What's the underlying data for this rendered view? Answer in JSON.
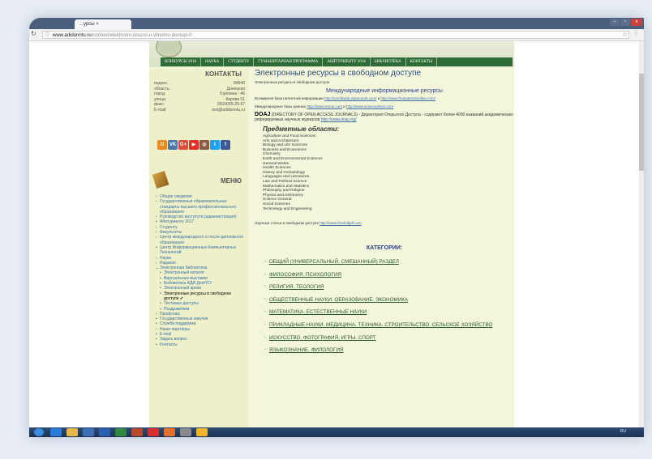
{
  "browser": {
    "tab_title": "...урсы ×",
    "tab_close": "×",
    "url_host": "www.adidonntu.ru",
    "url_path": "/content/elektronni-resursi-u-vilnomu-dostupi-0",
    "star_glyph": "☆",
    "menu_glyph": "⋮"
  },
  "nav": {
    "items": [
      "КОНКУРСЫ 2018",
      "НАУКА",
      "СТУДЕНТУ",
      "ГУМАНИТАРНАЯ ПРОГРАММА",
      "АБИТУРИЕНТУ 2018",
      "БИБЛИОТЕКА",
      "КОНТАКТЫ"
    ]
  },
  "contacts": {
    "title": "КОНТАКТЫ",
    "rows": [
      {
        "label": "индекс:",
        "value": "84646"
      },
      {
        "label": "область:",
        "value": "Донецкая"
      },
      {
        "label": "город:",
        "value": "Горловка - 46"
      },
      {
        "label": "улица:",
        "value": "Кирова 51"
      },
      {
        "label": "факс:",
        "value": "(0624)55-29-67"
      },
      {
        "label": "E-mail:",
        "value": "inst@adidonntu.ru"
      }
    ]
  },
  "social": [
    {
      "glyph": "O",
      "color": "#f08a1e"
    },
    {
      "glyph": "VK",
      "color": "#4a76a8"
    },
    {
      "glyph": "G+",
      "color": "#dd4b39"
    },
    {
      "glyph": "▶",
      "color": "#e52d27"
    },
    {
      "glyph": "◎",
      "color": "#8a5a44"
    },
    {
      "glyph": "t",
      "color": "#1da1f2"
    },
    {
      "glyph": "f",
      "color": "#3b5998"
    }
  ],
  "menu": {
    "title": "МЕНЮ",
    "items": [
      {
        "label": "Общие сведения",
        "sub": false,
        "bullet": "›"
      },
      {
        "label": "Государственные образовательные стандарты высшего профессионального образования",
        "sub": false,
        "bullet": "›"
      },
      {
        "label": "Руководство института (администрация)",
        "sub": false,
        "bullet": "›"
      },
      {
        "label": "Абитуриенту 2017",
        "sub": false,
        "bullet": "•"
      },
      {
        "label": "Студенту",
        "sub": false,
        "bullet": "›"
      },
      {
        "label": "Факультеты",
        "sub": false,
        "bullet": "›"
      },
      {
        "label": "Центр международного и после-дипломного образования",
        "sub": false,
        "bullet": "›"
      },
      {
        "label": "Центр Информационных Компьютерных Технологий",
        "sub": false,
        "bullet": "•"
      },
      {
        "label": "Наука",
        "sub": false,
        "bullet": "›"
      },
      {
        "label": "Издания",
        "sub": false,
        "bullet": "›"
      },
      {
        "label": "Электронная библиотека",
        "sub": false,
        "bullet": "⌄"
      },
      {
        "label": "Электронный каталог",
        "sub": true,
        "bullet": "•"
      },
      {
        "label": "Виртуальные выставки",
        "sub": true,
        "bullet": "•"
      },
      {
        "label": "Библиотека АДИ ДонНТУ",
        "sub": true,
        "bullet": "•"
      },
      {
        "label": "Электронный архив",
        "sub": true,
        "bullet": "•"
      },
      {
        "label": "Электронные ресурсы в свободном доступе ✔",
        "sub": true,
        "bullet": "•",
        "active": true
      },
      {
        "label": "Тестовые доступы",
        "sub": true,
        "bullet": "•"
      },
      {
        "label": "Поздравляем",
        "sub": true,
        "bullet": "•"
      },
      {
        "label": "Профсоюз",
        "sub": false,
        "bullet": "›"
      },
      {
        "label": "Государственные закупки",
        "sub": false,
        "bullet": "•"
      },
      {
        "label": "Служба поддержки",
        "sub": false,
        "bullet": "•"
      },
      {
        "label": "Наши партнёры",
        "sub": false,
        "bullet": "›"
      },
      {
        "label": "E-mail",
        "sub": false,
        "bullet": "•"
      },
      {
        "label": "Задать вопрос",
        "sub": false,
        "bullet": "•"
      },
      {
        "label": "Контакты",
        "sub": false,
        "bullet": "•"
      }
    ]
  },
  "main": {
    "title": "Электронные ресурсы в свободном доступе",
    "breadcrumb": "Электронные ресурсы в свободном доступе",
    "intl_title": "Международные информационные ресурсы",
    "patent_text": "Всемирная база патентной информации ",
    "patent_link1": "http://worldwide.espacenet.com/",
    "patent_and": " и ",
    "patent_link2": "http://www.freepatentsonline.com/",
    "science_text": "Международные базы данных ",
    "science_link1": "http://www.scirus.com",
    "science_and": " и ",
    "science_link2": "http://www.sciencedirect.com",
    "doaj_name": "DOAJ",
    "doaj_text": " (DIRECTORY OF OPEN ACCESS JOURNALS) - Директория Открытого Доступа - содержит более 4000 названий академических реферируемых научных журналов ",
    "doaj_link": "http://www.doaj.org/",
    "subjects_title": "Предметные области:",
    "subjects": [
      "Agriculture and Food Sciences",
      "Arts and Architecture",
      "Biology and Life Sciences",
      "Business and Economics",
      "Chemistry",
      "Earth and Environmental Sciences",
      "General Works",
      "Health Sciences",
      "History and Archaeology",
      "Languages and Literatures",
      "Law and Political Science",
      "Mathematics and Statistics",
      "Philosophy and Religion",
      "Physics and Astronomy",
      "Science General",
      "Social Sciences",
      "Technology and Engineering"
    ],
    "articles_text": "Научные статьи в свободном доступе ",
    "articles_link": "http://www.freefullpdf.com",
    "categories_title": "КАТЕГОРИИ:",
    "categories": [
      "ОБЩИЙ (УНИВЕРСАЛЬНЫЙ, СМЕШАННЫЙ) РАЗДЕЛ",
      "ФИЛОСОФИЯ. ПСИХОЛОГИЯ",
      "РЕЛИГИЯ. ТЕОЛОГИЯ",
      "ОБЩЕСТВЕННЫЕ НАУКИ. ОБРАЗОВАНИЕ. ЭКОНОМИКА",
      "МАТЕМАТИКА. ЕСТЕСТВЕННЫЕ НАУКИ",
      "ПРИКЛАДНЫЕ НАУКИ. МЕДИЦИНА. ТЕХНИКА. СТРОИТЕЛЬСТВО. СЕЛЬСКОЕ ХОЗЯЙСТВО",
      "ИСКУССТВО. ФОТОГРАФИЯ. ИГРЫ. СПОРТ",
      "ЯЗЫКОЗНАНИЕ. ФИЛОЛОГИЯ"
    ]
  },
  "taskbar": {
    "lang": "RU"
  }
}
